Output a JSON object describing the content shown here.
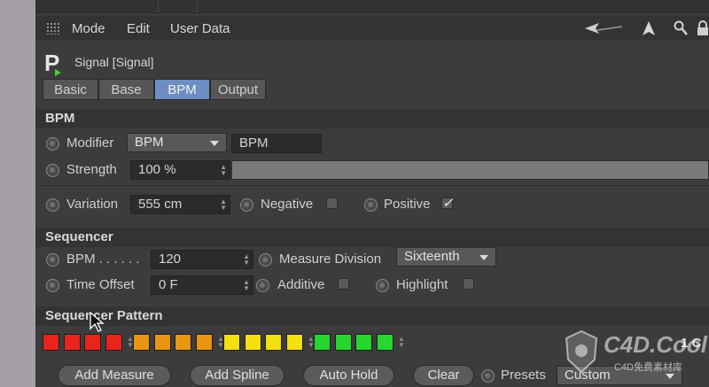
{
  "menubar": {
    "items": [
      "Mode",
      "Edit",
      "User Data"
    ],
    "icons": [
      "back-arrow-icon",
      "cursor-arrow-icon",
      "search-icon",
      "lock-icon"
    ]
  },
  "object": {
    "title": "Signal [Signal]",
    "icon": "python-tag-icon"
  },
  "tabs": [
    {
      "label": "Basic",
      "active": false
    },
    {
      "label": "Base",
      "active": false
    },
    {
      "label": "BPM",
      "active": true
    },
    {
      "label": "Output",
      "active": false
    }
  ],
  "bpm_section": {
    "title": "BPM",
    "modifier": {
      "label": "Modifier",
      "dropdown": "BPM",
      "value": "BPM"
    },
    "strength": {
      "label": "Strength",
      "value": "100 %",
      "slider_fraction": 1.0
    },
    "variation": {
      "label": "Variation",
      "value": "555 cm"
    },
    "negative": {
      "label": "Negative",
      "checked": false
    },
    "positive": {
      "label": "Positive",
      "checked": true,
      "mark": "✓"
    }
  },
  "sequencer_section": {
    "title": "Sequencer",
    "bpm": {
      "label": "BPM . . . . . .",
      "value": "120"
    },
    "measure_division": {
      "label": "Measure Division",
      "value": "Sixteenth"
    },
    "time_offset": {
      "label": "Time Offset",
      "value": "0 F"
    },
    "additive": {
      "label": "Additive",
      "checked": false
    },
    "highlight": {
      "label": "Highlight",
      "checked": false
    }
  },
  "pattern_section": {
    "title": "Sequencer Pattern",
    "colors": {
      "red": "#e8241c",
      "orange": "#e89612",
      "yellow": "#f2e010",
      "green": "#27d62f"
    },
    "step_groups": [
      "red",
      "orange",
      "yellow",
      "green"
    ],
    "trailing_text": "1 C"
  },
  "buttons": [
    {
      "label": "Add Measure"
    },
    {
      "label": "Add Spline"
    },
    {
      "label": "Auto Hold"
    },
    {
      "label": "Clear"
    }
  ],
  "presets": {
    "label": "Presets",
    "value": "Custom"
  },
  "watermark": {
    "text": "C4D.Cool",
    "subtitle": "C4D免费素材库"
  }
}
